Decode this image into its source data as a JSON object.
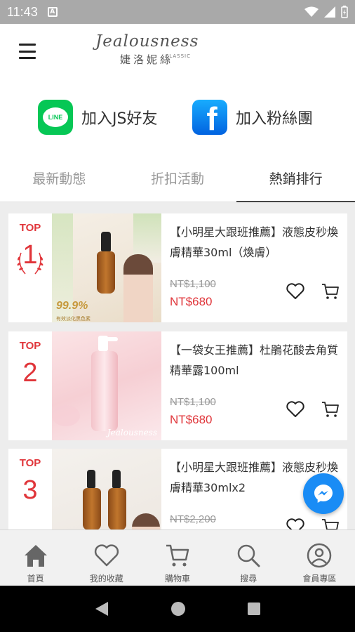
{
  "status_bar": {
    "time": "11:43",
    "notification_icon": "A"
  },
  "header": {
    "logo_script": "Jealousness",
    "logo_classic": "CLASSIC",
    "logo_chinese": "婕洛妮絲"
  },
  "social": {
    "line_logo_text": "LINE",
    "line_label": "加入JS好友",
    "facebook_label": "加入粉絲團"
  },
  "tabs": [
    {
      "label": "最新動態",
      "active": false
    },
    {
      "label": "折扣活動",
      "active": false
    },
    {
      "label": "熱銷排行",
      "active": true
    }
  ],
  "products": [
    {
      "top_label": "TOP",
      "rank": "1",
      "title": "【小明星大跟班推薦】液態皮秒煥膚精華30ml（煥膚）",
      "old_price": "NT$1,100",
      "new_price": "NT$680",
      "badge": "99.9%",
      "badge_sub": "有效淡化黑色素"
    },
    {
      "top_label": "TOP",
      "rank": "2",
      "title": "【一袋女王推薦】杜鵑花酸去角質精華露100ml",
      "old_price": "NT$1,100",
      "new_price": "NT$680",
      "watermark": "Jealousness"
    },
    {
      "top_label": "TOP",
      "rank": "3",
      "title": "【小明星大跟班推薦】液態皮秒煥膚精華30mlx2",
      "old_price": "NT$2,200",
      "new_price": ""
    }
  ],
  "bottom_nav": [
    {
      "label": "首頁",
      "icon": "home-icon"
    },
    {
      "label": "我的收藏",
      "icon": "heart-icon"
    },
    {
      "label": "購物車",
      "icon": "cart-icon"
    },
    {
      "label": "搜尋",
      "icon": "search-icon"
    },
    {
      "label": "會員專區",
      "icon": "user-icon"
    }
  ],
  "colors": {
    "accent_red": "#e0353a",
    "line_green": "#06c755",
    "facebook_blue": "#1877f2",
    "messenger_blue": "#1a8cf5"
  }
}
